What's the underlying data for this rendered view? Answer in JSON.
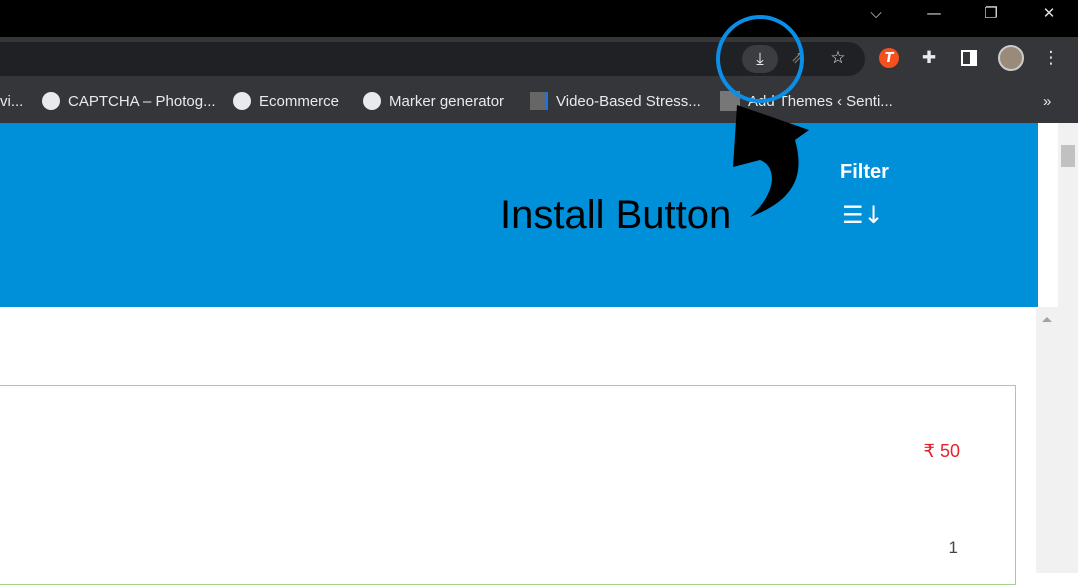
{
  "window": {
    "controls": [
      "tab-search",
      "minimize",
      "restore",
      "close"
    ]
  },
  "toolbar": {
    "icons": [
      "install-app-icon",
      "share-icon",
      "star-icon",
      "extension-t-icon",
      "puzzle-icon",
      "side-panel-icon",
      "avatar",
      "menu-icon"
    ]
  },
  "bookmarks": {
    "items": [
      {
        "label": "vi...",
        "icon": "generic"
      },
      {
        "label": "CAPTCHA – Photog...",
        "icon": "globe-icon"
      },
      {
        "label": "Ecommerce",
        "icon": "github-icon"
      },
      {
        "label": "Marker generator",
        "icon": "globe-icon"
      },
      {
        "label": "Video-Based Stress...",
        "icon": "chevron-icon"
      },
      {
        "label": "Add Themes ‹ Senti...",
        "icon": "site-icon"
      }
    ],
    "overflow": "»"
  },
  "annotation": {
    "label": "Install Button",
    "color": "#0a8fe8"
  },
  "header": {
    "filter_label": "Filter",
    "sort_icon": "☰↓"
  },
  "card": {
    "price": "₹ 50",
    "quantity": "1"
  },
  "colors": {
    "header": "#0090d9",
    "price": "#e4222f"
  }
}
